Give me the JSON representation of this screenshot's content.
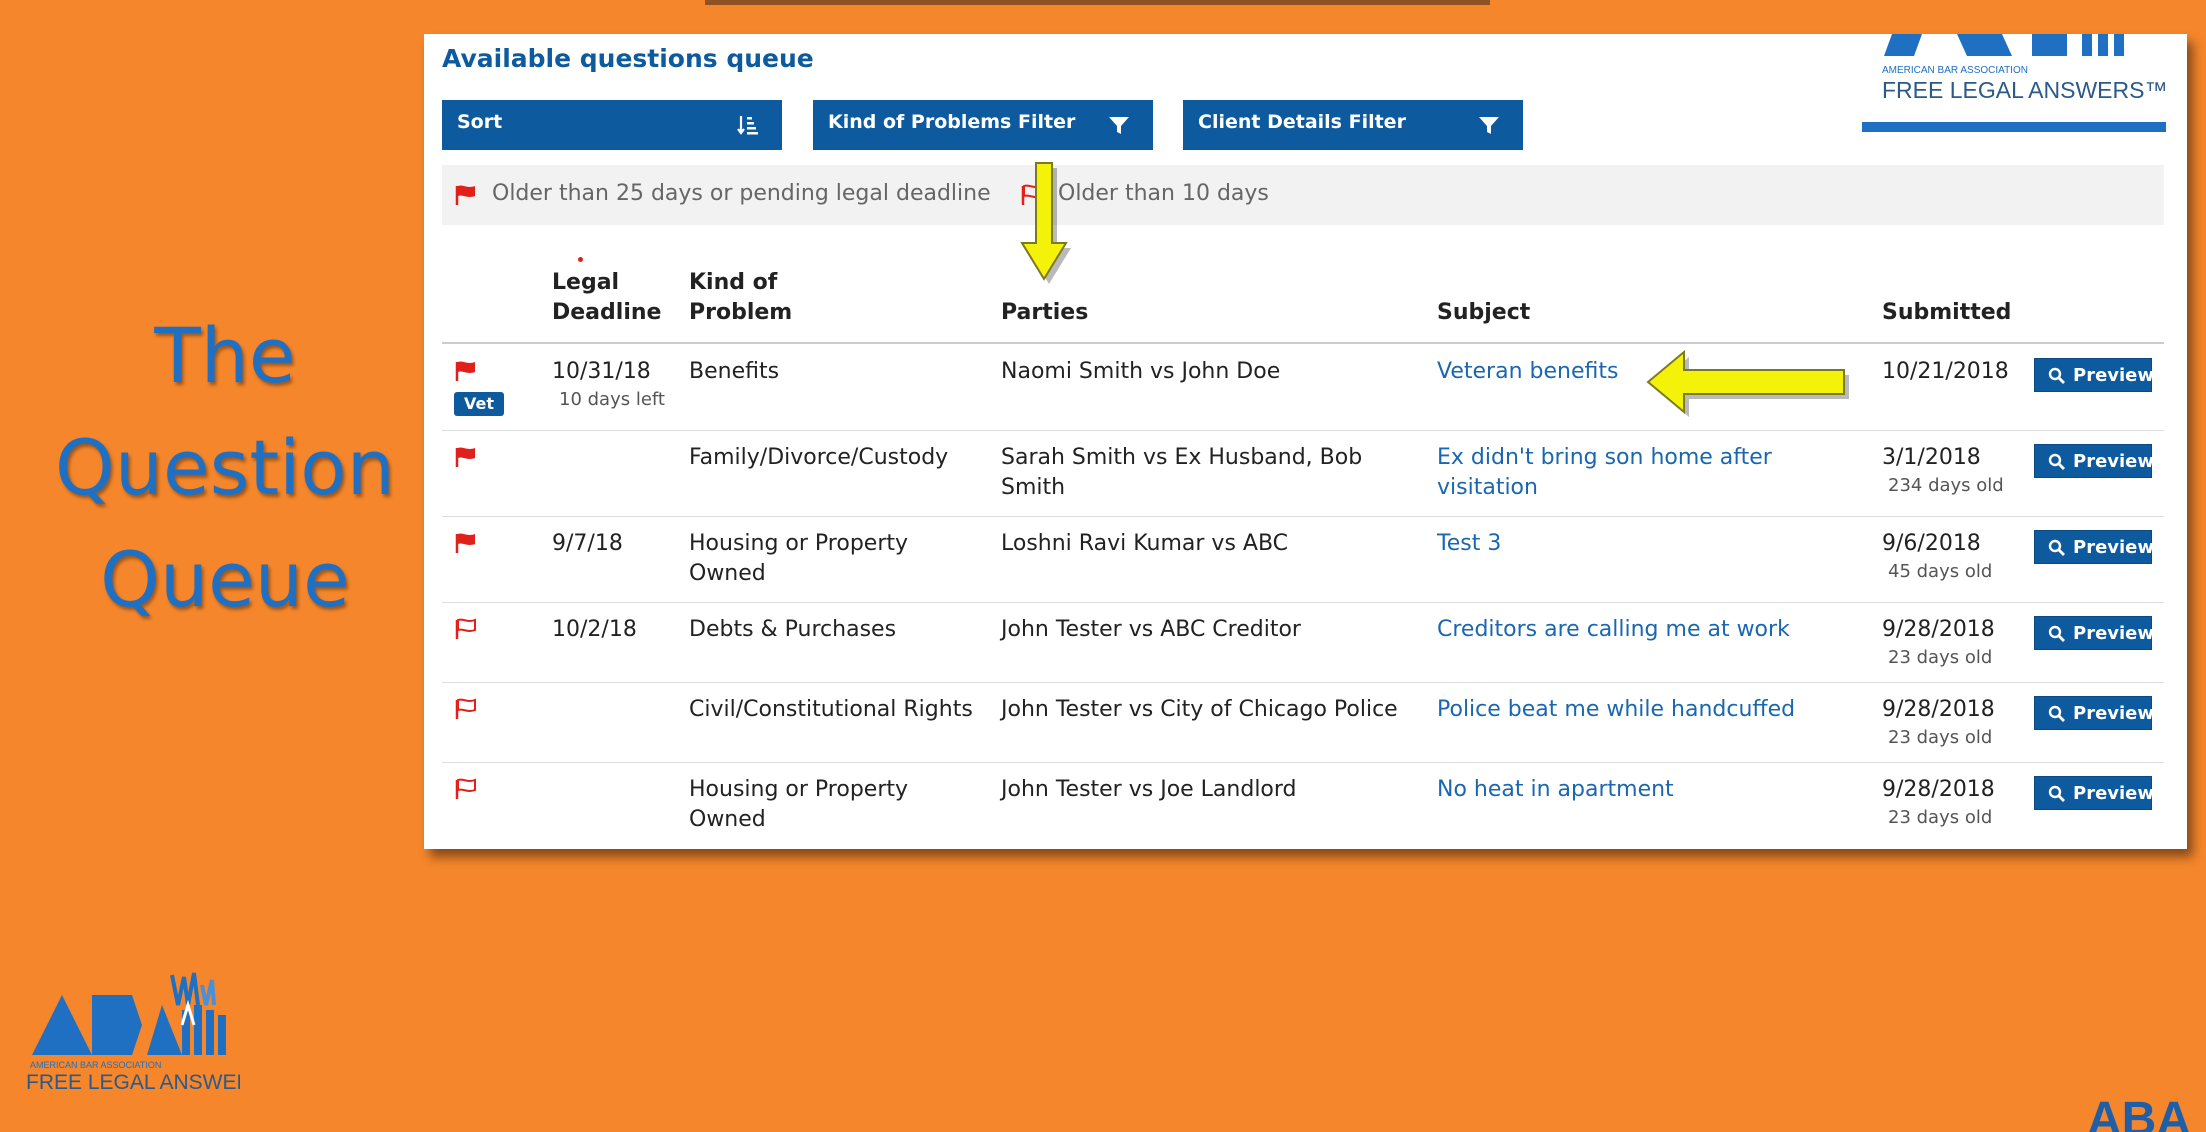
{
  "slide": {
    "title_lines": [
      "The",
      "Question",
      "Queue"
    ],
    "brand_small": "AMERICAN BAR ASSOCIATION",
    "brand_name": "FREE LEGAL ANSWERS",
    "corner_text": "ABA"
  },
  "panel": {
    "title": "Available questions queue",
    "logo_small": "AMERICAN BAR ASSOCIATION",
    "logo_name": "FREE LEGAL ANSWERS™"
  },
  "filters": {
    "sort_label": "Sort",
    "problems_label": "Kind of Problems Filter",
    "client_label": "Client Details Filter"
  },
  "legend": {
    "older_25": "Older than 25 days or pending legal deadline",
    "older_10": "Older than 10 days"
  },
  "table": {
    "headers": {
      "deadline_1": "Legal",
      "deadline_2": "Deadline",
      "kind_1": "Kind of",
      "kind_2": "Problem",
      "parties": "Parties",
      "subject": "Subject",
      "submitted": "Submitted"
    },
    "preview_label": "Preview",
    "rows": [
      {
        "flag": "solid",
        "badge": "Vet",
        "deadline": "10/31/18",
        "deadline_note": "10 days left",
        "kind_1": "Benefits",
        "kind_2": "",
        "parties_1": "Naomi Smith vs John Doe",
        "parties_2": "",
        "subject_1": "Veteran benefits",
        "subject_2": "",
        "submitted": "10/21/2018",
        "age": ""
      },
      {
        "flag": "solid",
        "badge": "",
        "deadline": "",
        "deadline_note": "",
        "kind_1": "Family/Divorce/Custody",
        "kind_2": "",
        "parties_1": "Sarah Smith vs Ex Husband, Bob",
        "parties_2": "Smith",
        "subject_1": "Ex didn't bring son home after",
        "subject_2": "visitation",
        "submitted": "3/1/2018",
        "age": "234 days old"
      },
      {
        "flag": "solid",
        "badge": "",
        "deadline": "9/7/18",
        "deadline_note": "",
        "kind_1": "Housing or Property",
        "kind_2": "Owned",
        "parties_1": "Loshni Ravi Kumar vs ABC",
        "parties_2": "",
        "subject_1": "Test 3",
        "subject_2": "",
        "submitted": "9/6/2018",
        "age": "45 days old"
      },
      {
        "flag": "outline",
        "badge": "",
        "deadline": "10/2/18",
        "deadline_note": "",
        "kind_1": "Debts & Purchases",
        "kind_2": "",
        "parties_1": "John Tester vs ABC Creditor",
        "parties_2": "",
        "subject_1": "Creditors are calling me at work",
        "subject_2": "",
        "submitted": "9/28/2018",
        "age": "23 days old"
      },
      {
        "flag": "outline",
        "badge": "",
        "deadline": "",
        "deadline_note": "",
        "kind_1": "Civil/Constitutional Rights",
        "kind_2": "",
        "parties_1": "John Tester vs City of Chicago Police",
        "parties_2": "",
        "subject_1": "Police beat me while handcuffed",
        "subject_2": "",
        "submitted": "9/28/2018",
        "age": "23 days old"
      },
      {
        "flag": "outline",
        "badge": "",
        "deadline": "",
        "deadline_note": "",
        "kind_1": "Housing or Property",
        "kind_2": "Owned",
        "parties_1": "John Tester vs Joe Landlord",
        "parties_2": "",
        "subject_1": "No heat in apartment",
        "subject_2": "",
        "submitted": "9/28/2018",
        "age": "23 days old"
      }
    ]
  },
  "colors": {
    "background": "#F5862B",
    "title": "#1F6FC2",
    "button": "#0D5A9E",
    "link": "#1A67B0",
    "flag": "#E0211B",
    "arrow": "#F5F20A"
  },
  "icons": {
    "sort": "sort-descending-icon",
    "filter": "funnel-icon",
    "preview": "search-icon",
    "urgent_flag": "flag-solid-icon",
    "older_flag": "flag-outline-icon",
    "callout": "yellow-arrow-icon"
  }
}
